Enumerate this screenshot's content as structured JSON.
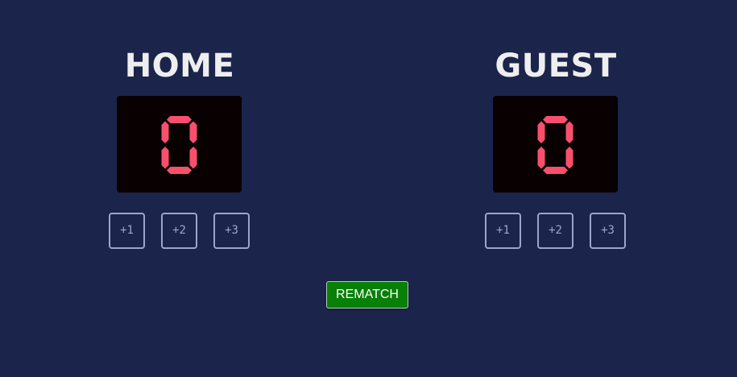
{
  "colors": {
    "background": "#1b244a",
    "score_panel": "#080001",
    "score_digit": "#f94f6d",
    "button_outline": "#9aa5cf",
    "rematch_bg": "#078007"
  },
  "home": {
    "title": "HOME",
    "score": "0",
    "buttons": [
      "+1",
      "+2",
      "+3"
    ]
  },
  "guest": {
    "title": "GUEST",
    "score": "0",
    "buttons": [
      "+1",
      "+2",
      "+3"
    ]
  },
  "rematch_label": "REMATCH"
}
